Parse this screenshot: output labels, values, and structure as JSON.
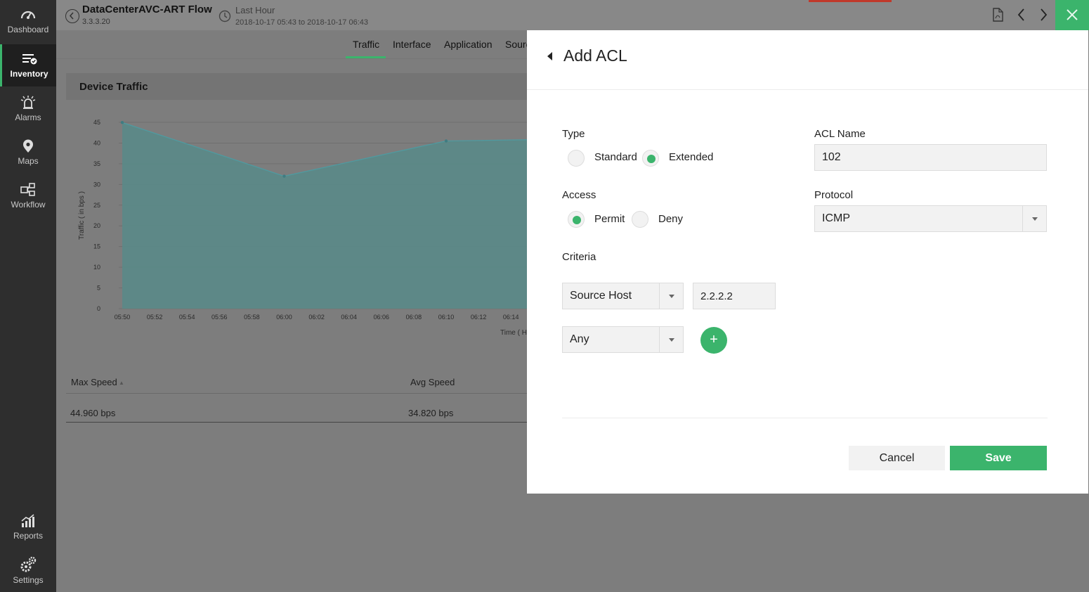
{
  "sidebar": {
    "items": [
      {
        "label": "Dashboard",
        "icon": "speedometer-icon"
      },
      {
        "label": "Inventory",
        "icon": "inventory-list-icon",
        "active": true
      },
      {
        "label": "Alarms",
        "icon": "alarm-siren-icon"
      },
      {
        "label": "Maps",
        "icon": "map-pin-icon"
      },
      {
        "label": "Workflow",
        "icon": "workflow-icon"
      },
      {
        "label": "Reports",
        "icon": "reports-chart-icon"
      },
      {
        "label": "Settings",
        "icon": "gears-icon"
      }
    ]
  },
  "header": {
    "title": "DataCenterAVC-ART Flow",
    "ip": "3.3.3.20",
    "period": "Last Hour",
    "range": "2018-10-17 05:43 to 2018-10-17 06:43"
  },
  "tabs": [
    "Traffic",
    "Interface",
    "Application",
    "Sourc"
  ],
  "panel": {
    "title": "Device Traffic"
  },
  "chart_data": {
    "type": "area",
    "ylabel": "Traffic ( in bps )",
    "xlabel": "Time ( H",
    "ylim": [
      0,
      45
    ],
    "yticks": [
      0,
      5,
      10,
      15,
      20,
      25,
      30,
      35,
      40,
      45
    ],
    "xticks": [
      "05:50",
      "05:52",
      "05:54",
      "05:56",
      "05:58",
      "06:00",
      "06:02",
      "06:04",
      "06:06",
      "06:08",
      "06:10",
      "06:12",
      "06:14"
    ],
    "points": [
      {
        "x": "05:50",
        "y": 44.96
      },
      {
        "x": "06:00",
        "y": 32.0
      },
      {
        "x": "06:10",
        "y": 40.5
      },
      {
        "x": "06:15",
        "y": 40.8
      }
    ],
    "color": "#5a8a88"
  },
  "table": {
    "headers": [
      "Max Speed",
      "Avg Speed"
    ],
    "row": [
      "44.960 bps",
      "34.820 bps"
    ]
  },
  "modal": {
    "title": "Add ACL",
    "type_label": "Type",
    "type_options": [
      "Standard",
      "Extended"
    ],
    "type_selected": "Extended",
    "acl_name_label": "ACL Name",
    "acl_name_value": "102",
    "access_label": "Access",
    "access_options": [
      "Permit",
      "Deny"
    ],
    "access_selected": "Permit",
    "protocol_label": "Protocol",
    "protocol_value": "ICMP",
    "criteria_label": "Criteria",
    "criteria_source": "Source Host",
    "criteria_ip": "2.2.2.2",
    "criteria_dest": "Any",
    "add_label": "+",
    "cancel_label": "Cancel",
    "save_label": "Save"
  },
  "colors": {
    "accent": "#3bb46c",
    "sidebar": "#2e2e2e",
    "overlay": "#7d7d7d"
  }
}
